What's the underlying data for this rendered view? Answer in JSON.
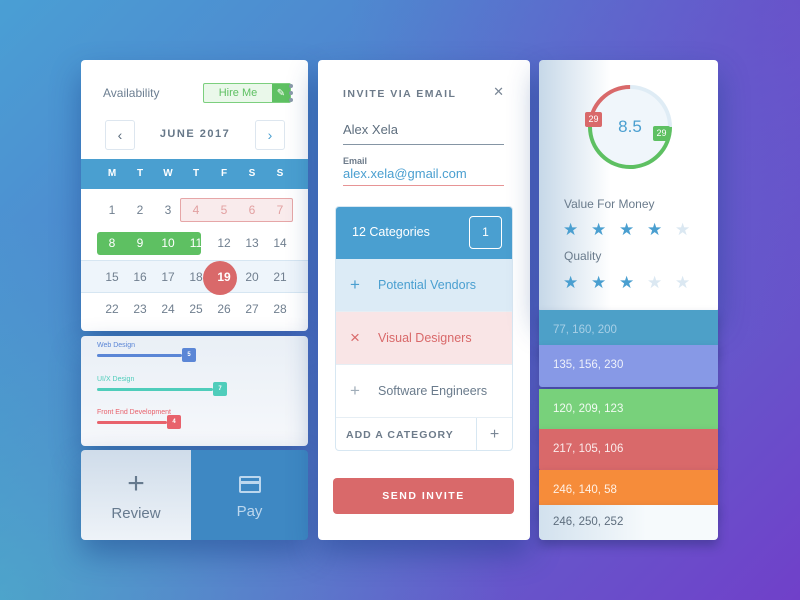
{
  "calendar": {
    "availability_label": "Availability",
    "hire_button": "Hire Me",
    "edit_icon": "pencil-icon",
    "more_icon": "more-vertical-icon",
    "month": "JUNE 2017",
    "prev_icon": "chevron-left-icon",
    "next_icon": "chevron-right-icon",
    "weekdays": [
      "M",
      "T",
      "W",
      "T",
      "F",
      "S",
      "S"
    ],
    "weeks": [
      [
        "1",
        "2",
        "3",
        "4",
        "5",
        "6",
        "7"
      ],
      [
        "8",
        "9",
        "10",
        "11",
        "12",
        "13",
        "14"
      ],
      [
        "15",
        "16",
        "17",
        "18",
        "19",
        "20",
        "21"
      ],
      [
        "22",
        "23",
        "24",
        "25",
        "26",
        "27",
        "28"
      ]
    ],
    "unavailable_days": [
      "4",
      "5",
      "6",
      "7"
    ],
    "booked_days": [
      "8",
      "9",
      "10",
      "11"
    ],
    "selected_day": "19"
  },
  "skills": [
    {
      "label": "Web Design",
      "value": "5",
      "max": 10,
      "color": "#5b86d6"
    },
    {
      "label": "UI/X Design",
      "value": "7",
      "max": 10,
      "color": "#4fcdbb"
    },
    {
      "label": "Front End Development",
      "value": "4",
      "max": 10,
      "color": "#e8626c"
    }
  ],
  "actions": {
    "review": {
      "label": "Review",
      "icon": "plus-icon"
    },
    "pay": {
      "label": "Pay",
      "icon": "credit-card-icon"
    }
  },
  "invite": {
    "title": "INVITE VIA EMAIL",
    "close_icon": "close-icon",
    "name_value": "Alex Xela",
    "email_label": "Email",
    "email_value": "alex.xela@gmail.com",
    "categories_title": "12 Categories",
    "categories_count": "1",
    "categories": [
      {
        "label": "Potential Vendors",
        "state": "add",
        "icon": "+"
      },
      {
        "label": "Visual Designers",
        "state": "selected",
        "icon": "×"
      },
      {
        "label": "Software Engineers",
        "state": "add",
        "icon": "+"
      }
    ],
    "add_category_label": "ADD A CATEGORY",
    "add_category_icon": "+",
    "send_button": "SEND INVITE"
  },
  "rating": {
    "score": "8.5",
    "negative_count": "29",
    "positive_count": "29",
    "negative_fraction": 0.25,
    "positive_fraction": 0.5,
    "criteria": [
      {
        "label": "Value For Money",
        "stars": 4,
        "max": 5
      },
      {
        "label": "Quality",
        "stars": 3,
        "max": 5
      }
    ]
  },
  "swatches": [
    {
      "label": "77, 160, 200",
      "color": "#4da0c8"
    },
    {
      "label": "135, 156, 230",
      "color": "#879ce6"
    },
    {
      "label": "120, 209, 123",
      "color": "#78d17b"
    },
    {
      "label": "217, 105, 106",
      "color": "#d9696a"
    },
    {
      "label": "246, 140, 58",
      "color": "#f68c3a"
    },
    {
      "label": "246, 250, 252",
      "color": "#f6fafc"
    }
  ]
}
